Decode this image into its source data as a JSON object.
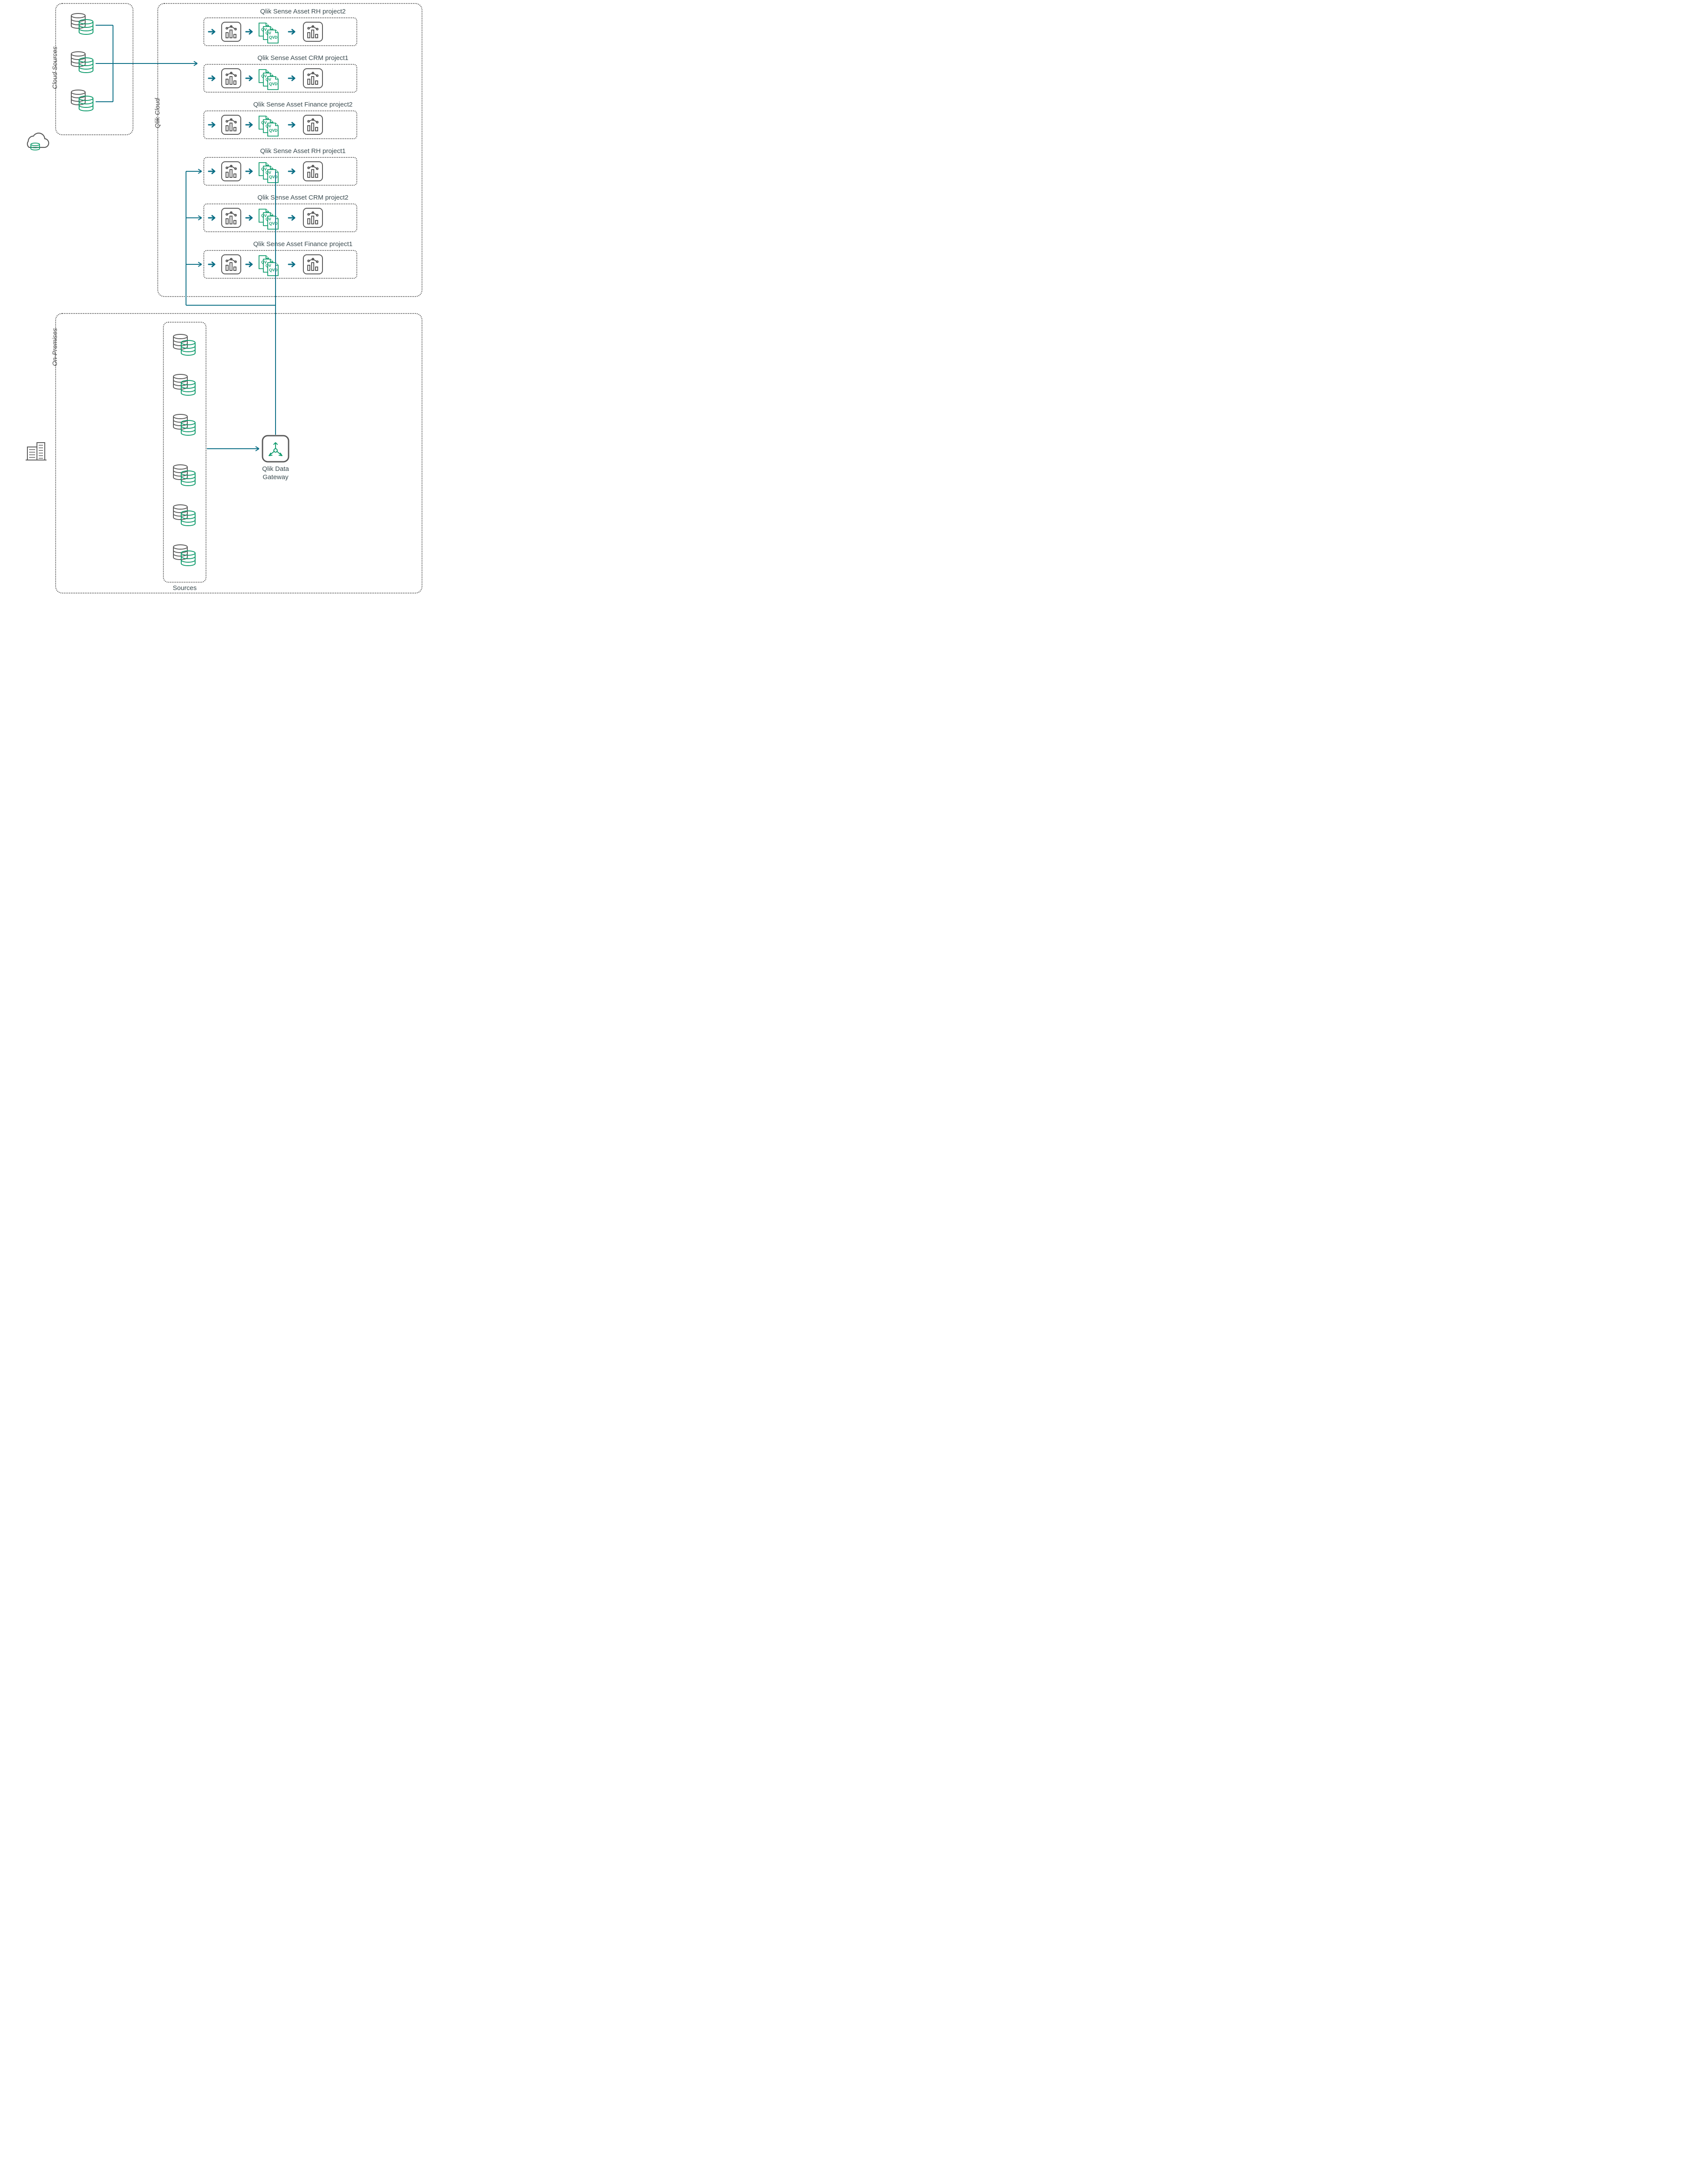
{
  "labels": {
    "cloud_sources": "Cloud Sources",
    "qlik_cloud": "Qlik Cloud",
    "on_premises": "On-Premises",
    "sources_bottom": "Sources"
  },
  "gateway": {
    "line1": "Qlik Data",
    "line2": "Gateway"
  },
  "assets": [
    {
      "title": "Qlik Sense Asset RH project2"
    },
    {
      "title": "Qlik Sense Asset CRM project1"
    },
    {
      "title": "Qlik Sense Asset Finance project2"
    },
    {
      "title": "Qlik Sense Asset RH project1"
    },
    {
      "title": "Qlik Sense Asset CRM project2"
    },
    {
      "title": "Qlik Sense Asset Finance project1"
    }
  ],
  "qvd_labels": {
    "a": "QV",
    "b": "QV",
    "c": "QVD"
  }
}
